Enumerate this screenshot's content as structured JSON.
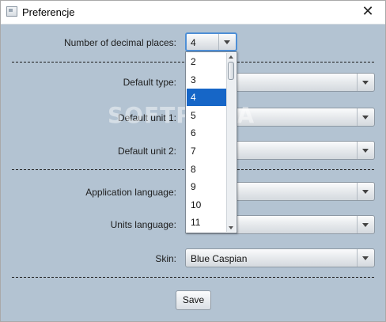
{
  "window": {
    "title": "Preferencje",
    "close_glyph": "✕",
    "watermark": "SOFTPEDIA"
  },
  "form": {
    "decimal_places": {
      "label": "Number of decimal places:",
      "value": "4"
    },
    "default_type": {
      "label": "Default type:",
      "value": ""
    },
    "default_unit1": {
      "label": "Default unit 1:",
      "value": ""
    },
    "default_unit2": {
      "label": "Default unit 2:",
      "value": ""
    },
    "app_language": {
      "label": "Application language:",
      "value": ""
    },
    "units_language": {
      "label": "Units language:",
      "value": ""
    },
    "skin": {
      "label": "Skin:",
      "value": "Blue Caspian"
    }
  },
  "dropdown": {
    "options": [
      "2",
      "3",
      "4",
      "5",
      "6",
      "7",
      "8",
      "9",
      "10",
      "11"
    ],
    "selected": "4"
  },
  "save_label": "Save",
  "colors": {
    "window_bg": "#b3c3d2",
    "selection": "#1666c7",
    "focus": "#4e8fd6"
  }
}
